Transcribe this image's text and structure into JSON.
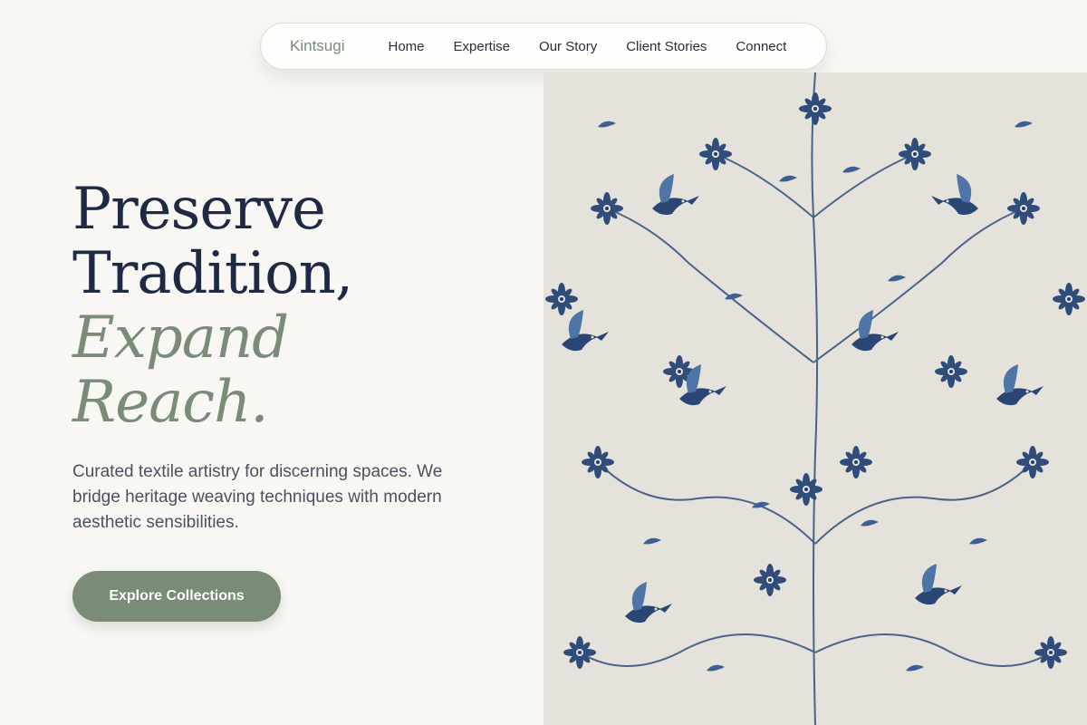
{
  "nav": {
    "brand": "Kintsugi",
    "links": [
      "Home",
      "Expertise",
      "Our Story",
      "Client Stories",
      "Connect"
    ]
  },
  "hero": {
    "title_line1": "Preserve",
    "title_line2": "Tradition,",
    "title_accent_line1": "Expand",
    "title_accent_line2": "Reach.",
    "subtitle": "Curated textile artistry for discerning spaces. We bridge heritage weaving techniques with modern aesthetic sensibilities.",
    "cta_label": "Explore Collections",
    "image_icon": "blue-floral-textile-image"
  },
  "colors": {
    "background": "#f8f7f4",
    "accent": "#7a8b77",
    "heading": "#1e2a44",
    "text": "#4a5160",
    "textile_background": "#e5e2db",
    "textile_ink": "#2f4c7a"
  }
}
